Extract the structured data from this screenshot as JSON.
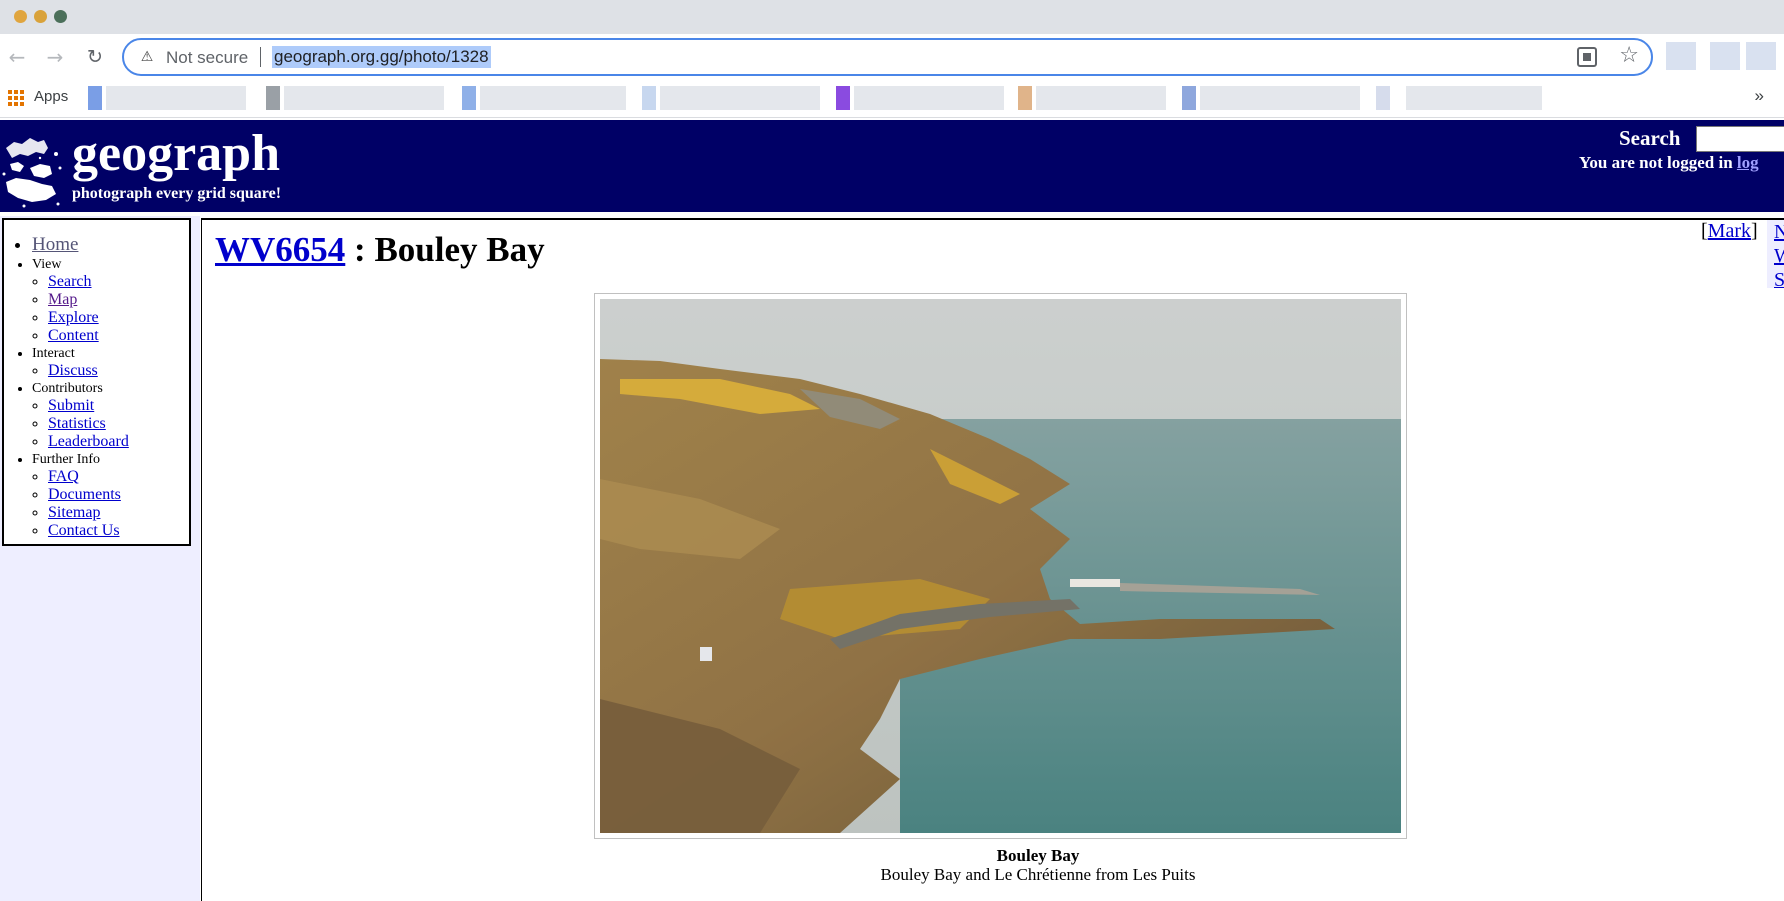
{
  "browser": {
    "security_label": "Not secure",
    "url": "geograph.org.gg/photo/1328",
    "apps_label": "Apps",
    "bookmarks_overflow": "»",
    "icons": [
      "back-arrow",
      "forward-arrow",
      "reload",
      "warning-triangle",
      "qr-code",
      "star",
      "apps-grid"
    ]
  },
  "header": {
    "logo_word": "geograph",
    "logo_tagline": "photograph every grid square!",
    "search_label": "Search",
    "login_text": "You are not logged in ",
    "login_link": "log"
  },
  "nav": {
    "home": "Home",
    "sections": [
      {
        "label": "View",
        "items": [
          "Search",
          "Map",
          "Explore",
          "Content"
        ]
      },
      {
        "label": "Interact",
        "items": [
          "Discuss"
        ]
      },
      {
        "label": "Contributors",
        "items": [
          "Submit",
          "Statistics",
          "Leaderboard"
        ]
      },
      {
        "label": "Further Info",
        "items": [
          "FAQ",
          "Documents",
          "Sitemap",
          "Contact Us"
        ]
      }
    ]
  },
  "main": {
    "grid_ref": "WV6654",
    "title_sep": " : ",
    "title": "Bouley Bay",
    "mark_open": "[",
    "mark_label": "Mark",
    "mark_close": "]",
    "right_nav": [
      "N",
      "W",
      "S"
    ],
    "caption_title": "Bouley Bay",
    "caption_text": "Bouley Bay and Le Chrétienne from Les Puits"
  },
  "colors": {
    "header_bg": "#000066",
    "sidebar_bg": "#eeeeff",
    "link": "#0000cc",
    "omnibox_focus": "#4a86e8"
  }
}
